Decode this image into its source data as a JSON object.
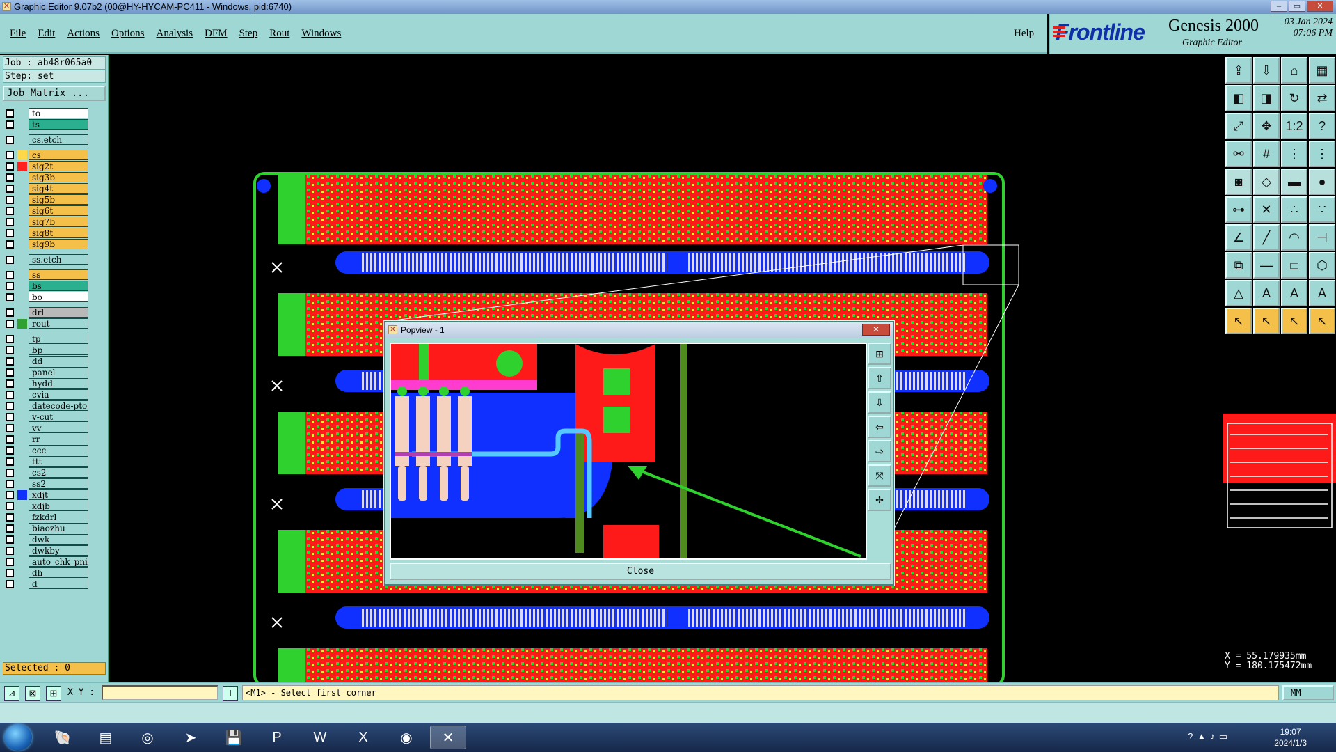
{
  "window": {
    "title": "Graphic Editor 9.07b2 (00@HY-HYCAM-PC411 - Windows, pid:6740)",
    "buttons": [
      "–",
      "▭",
      "✕"
    ]
  },
  "menu": {
    "items": [
      "File",
      "Edit",
      "Actions",
      "Options",
      "Analysis",
      "DFM",
      "Step",
      "Rout",
      "Windows"
    ],
    "help": "Help"
  },
  "brand": {
    "logo": "Frontline",
    "product": "Genesis 2000",
    "subtitle": "Graphic Editor",
    "date": "03 Jan 2024",
    "time": "07:06 PM"
  },
  "job": {
    "job_line": "Job : ab48r065a0",
    "step_line": "Step: set",
    "matrix_button": "Job Matrix ..."
  },
  "layers": [
    {
      "name": "to",
      "color": "#ffffff",
      "swatch": "",
      "gap_before": false
    },
    {
      "name": "ts",
      "color": "#2bb08f",
      "swatch": "",
      "gap_before": false
    },
    {
      "name": "cs.etch",
      "color": "#9ed7d3",
      "swatch": "",
      "gap_before": true
    },
    {
      "name": "cs",
      "color": "#f5c04a",
      "swatch": "#ffd84a",
      "gap_before": true
    },
    {
      "name": "sig2t",
      "color": "#f5c04a",
      "swatch": "#ff2020",
      "gap_before": false
    },
    {
      "name": "sig3b",
      "color": "#f5c04a",
      "swatch": "",
      "gap_before": false
    },
    {
      "name": "sig4t",
      "color": "#f5c04a",
      "swatch": "",
      "gap_before": false
    },
    {
      "name": "sig5b",
      "color": "#f5c04a",
      "swatch": "",
      "gap_before": false
    },
    {
      "name": "sig6t",
      "color": "#f5c04a",
      "swatch": "",
      "gap_before": false
    },
    {
      "name": "sig7b",
      "color": "#f5c04a",
      "swatch": "",
      "gap_before": false
    },
    {
      "name": "sig8t",
      "color": "#f5c04a",
      "swatch": "",
      "gap_before": false
    },
    {
      "name": "sig9b",
      "color": "#f5c04a",
      "swatch": "",
      "gap_before": false
    },
    {
      "name": "ss.etch",
      "color": "#9ed7d3",
      "swatch": "",
      "gap_before": true
    },
    {
      "name": "ss",
      "color": "#f5c04a",
      "swatch": "",
      "gap_before": true
    },
    {
      "name": "bs",
      "color": "#2bb08f",
      "swatch": "",
      "gap_before": false
    },
    {
      "name": "bo",
      "color": "#ffffff",
      "swatch": "",
      "gap_before": false
    },
    {
      "name": "drl",
      "color": "#b9b9b9",
      "swatch": "",
      "gap_before": true
    },
    {
      "name": "rout",
      "color": "#9ed7d3",
      "swatch": "#30a030",
      "gap_before": false
    },
    {
      "name": "tp",
      "color": "#9ed7d3",
      "swatch": "",
      "gap_before": true
    },
    {
      "name": "bp",
      "color": "#9ed7d3",
      "swatch": "",
      "gap_before": false
    },
    {
      "name": "dd",
      "color": "#9ed7d3",
      "swatch": "",
      "gap_before": false
    },
    {
      "name": "panel",
      "color": "#9ed7d3",
      "swatch": "",
      "gap_before": false
    },
    {
      "name": "hydd",
      "color": "#9ed7d3",
      "swatch": "",
      "gap_before": false
    },
    {
      "name": "cvia",
      "color": "#9ed7d3",
      "swatch": "",
      "gap_before": false
    },
    {
      "name": "datecode-pto",
      "color": "#9ed7d3",
      "swatch": "",
      "gap_before": false
    },
    {
      "name": "v-cut",
      "color": "#9ed7d3",
      "swatch": "",
      "gap_before": false
    },
    {
      "name": "vv",
      "color": "#9ed7d3",
      "swatch": "",
      "gap_before": false
    },
    {
      "name": "rr",
      "color": "#9ed7d3",
      "swatch": "",
      "gap_before": false
    },
    {
      "name": "ccc",
      "color": "#9ed7d3",
      "swatch": "",
      "gap_before": false
    },
    {
      "name": "ttt",
      "color": "#9ed7d3",
      "swatch": "",
      "gap_before": false
    },
    {
      "name": "cs2",
      "color": "#9ed7d3",
      "swatch": "",
      "gap_before": false
    },
    {
      "name": "ss2",
      "color": "#9ed7d3",
      "swatch": "",
      "gap_before": false
    },
    {
      "name": "xdjt",
      "color": "#9ed7d3",
      "swatch": "#1030ff",
      "gap_before": false
    },
    {
      "name": "xdjb",
      "color": "#9ed7d3",
      "swatch": "",
      "gap_before": false
    },
    {
      "name": "fzkdrl",
      "color": "#9ed7d3",
      "swatch": "",
      "gap_before": false
    },
    {
      "name": "biaozhu",
      "color": "#9ed7d3",
      "swatch": "",
      "gap_before": false
    },
    {
      "name": "dwk",
      "color": "#9ed7d3",
      "swatch": "",
      "gap_before": false
    },
    {
      "name": "dwkby",
      "color": "#9ed7d3",
      "swatch": "",
      "gap_before": false
    },
    {
      "name": "auto_chk_pni",
      "color": "#9ed7d3",
      "swatch": "",
      "gap_before": false
    },
    {
      "name": "dh",
      "color": "#9ed7d3",
      "swatch": "",
      "gap_before": false
    },
    {
      "name": "d",
      "color": "#9ed7d3",
      "swatch": "",
      "gap_before": false
    }
  ],
  "selected": "Selected : 0",
  "coords": {
    "x": "X = 55.179935mm",
    "y": "Y = 180.175472mm"
  },
  "status": {
    "xy_label": "X Y :",
    "xy_value": "",
    "message": "<M1> - Select first corner",
    "units": "MM"
  },
  "popview": {
    "title": "Popview - 1",
    "close_label": "Close",
    "close_x": "✕"
  },
  "taskbar": {
    "time": "19:07",
    "date": "2024/1/3"
  }
}
